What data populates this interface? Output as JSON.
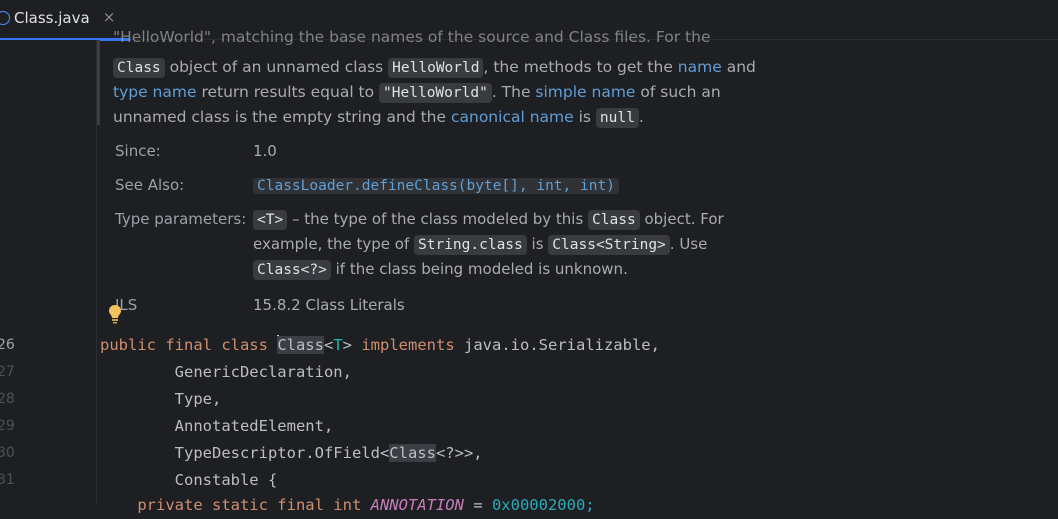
{
  "tab": {
    "title": "Class.java",
    "close": "×"
  },
  "doc": {
    "clipped_line": "\"HelloWorld\", matching the base names of the source and Class files. For the",
    "line1": {
      "chip1": "Class",
      "t1": " object of an unnamed class ",
      "chip2": "HelloWorld",
      "t2": ", the methods to get the ",
      "link1": "name",
      "t3": " and"
    },
    "line2": {
      "link1": "type name",
      "t1": " return results equal to ",
      "chip1": "\"HelloWorld\"",
      "t2": ". The ",
      "link2": "simple name",
      "t3": " of such an"
    },
    "line3": {
      "t1": "unnamed class is the empty string and the ",
      "link1": "canonical name",
      "t2": " is ",
      "chip1": "null",
      "t3": "."
    }
  },
  "tags": {
    "since_label": "Since:",
    "since_value": "1.0",
    "see_also_label": "See Also:",
    "see_also_value": "ClassLoader.defineClass(byte[], int, int)",
    "type_params_label": "Type parameters:",
    "tp_line1": {
      "chip1": "<T>",
      "t1": " – the type of the class modeled by this ",
      "chip2": "Class",
      "t2": " object. For"
    },
    "tp_line2": {
      "t1": "example, the type of ",
      "chip1": "String.class",
      "t2": " is ",
      "chip2": "Class<String>",
      "t3": ". Use"
    },
    "tp_line3": {
      "chip1": "Class<?>",
      "t1": " if the class being modeled is unknown."
    },
    "jls_label": "JLS",
    "jls_value": "15.8.2 Class Literals"
  },
  "gutter": {
    "lines": [
      "26",
      "27",
      "28",
      "29",
      "30",
      "31"
    ]
  },
  "code": {
    "l26": {
      "kw": "public final class ",
      "cls": "Class",
      "lt": "<",
      "tp": "T",
      "gt": "> ",
      "kw2": "implements",
      "rest": " java.io.Serializable,"
    },
    "l27": "        GenericDeclaration,",
    "l28": "        Type,",
    "l29": "        AnnotatedElement,",
    "l30": {
      "a": "        TypeDescriptor.OfField<",
      "cls": "Class",
      "b": "<?>>,"
    },
    "l31": "        Constable {",
    "l32": {
      "kw": "    private static final int ",
      "const": "ANNOTATION",
      "eq": "= ",
      "num": "0x00002000;"
    }
  },
  "colors": {
    "accent": "#3574f0",
    "keyword": "#cf8e6d",
    "type_param": "#16baac",
    "link": "#5f9fd6"
  }
}
